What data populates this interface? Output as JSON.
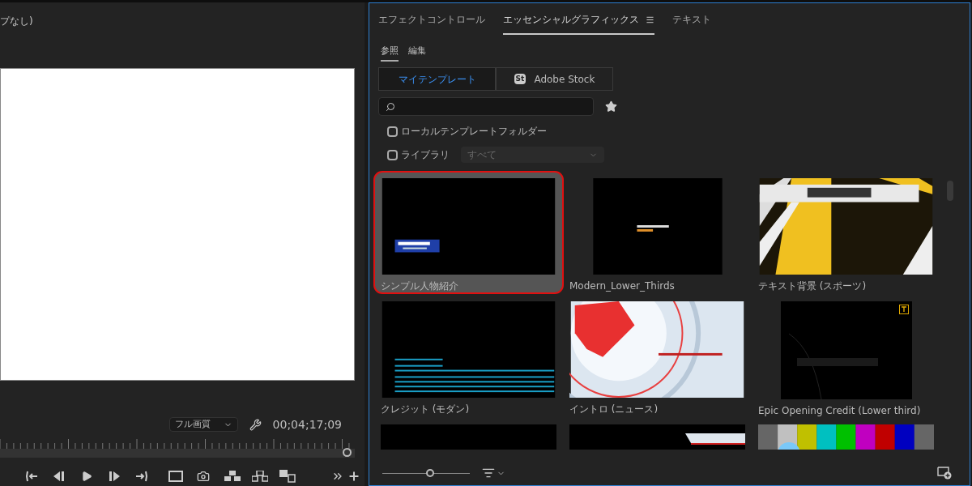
{
  "monitor": {
    "title": "プなし)",
    "quality": "フル画質",
    "timecode": "00;04;17;09",
    "playhead": {
      "level": 0.99
    }
  },
  "panel": {
    "tabs": [
      {
        "label": "エフェクトコントロール",
        "selected": false,
        "menu": false
      },
      {
        "label": "エッセンシャルグラフィックス",
        "selected": true,
        "menu": true
      },
      {
        "label": "テキスト",
        "selected": false,
        "menu": false
      }
    ],
    "subtabs": [
      {
        "label": "参照",
        "selected": true
      },
      {
        "label": "編集",
        "selected": false
      }
    ],
    "sources": [
      {
        "label": "マイテンプレート",
        "selected": true
      },
      {
        "label": "Adobe Stock",
        "badge": "St",
        "selected": false
      }
    ],
    "filters": [
      {
        "label": "ローカルテンプレートフォルダー",
        "checked": false
      },
      {
        "label": "ライブラリ",
        "checked": false,
        "dropdown": {
          "value": "すべて",
          "disabled": true
        }
      }
    ],
    "templates": [
      {
        "label": "シンプル人物紹介",
        "kind": "name-bar",
        "selected": true
      },
      {
        "label": "Modern_Lower_Thirds",
        "kind": "small-bar",
        "selected": false
      },
      {
        "label": "テキスト背景 (スポーツ)",
        "kind": "sports",
        "selected": false
      },
      {
        "label": "クレジット (モダン)",
        "kind": "credits",
        "selected": false
      },
      {
        "label": "イントロ (ニュース)",
        "kind": "globe",
        "selected": false
      },
      {
        "label": "Epic Opening Credit (Lower third)",
        "kind": "dark",
        "selected": false
      },
      {
        "kind": "black",
        "selected": false
      },
      {
        "kind": "live-bar",
        "selected": false
      },
      {
        "kind": "color-bars",
        "selected": false
      }
    ],
    "thumbnail_size": {
      "level": 0.55
    }
  }
}
